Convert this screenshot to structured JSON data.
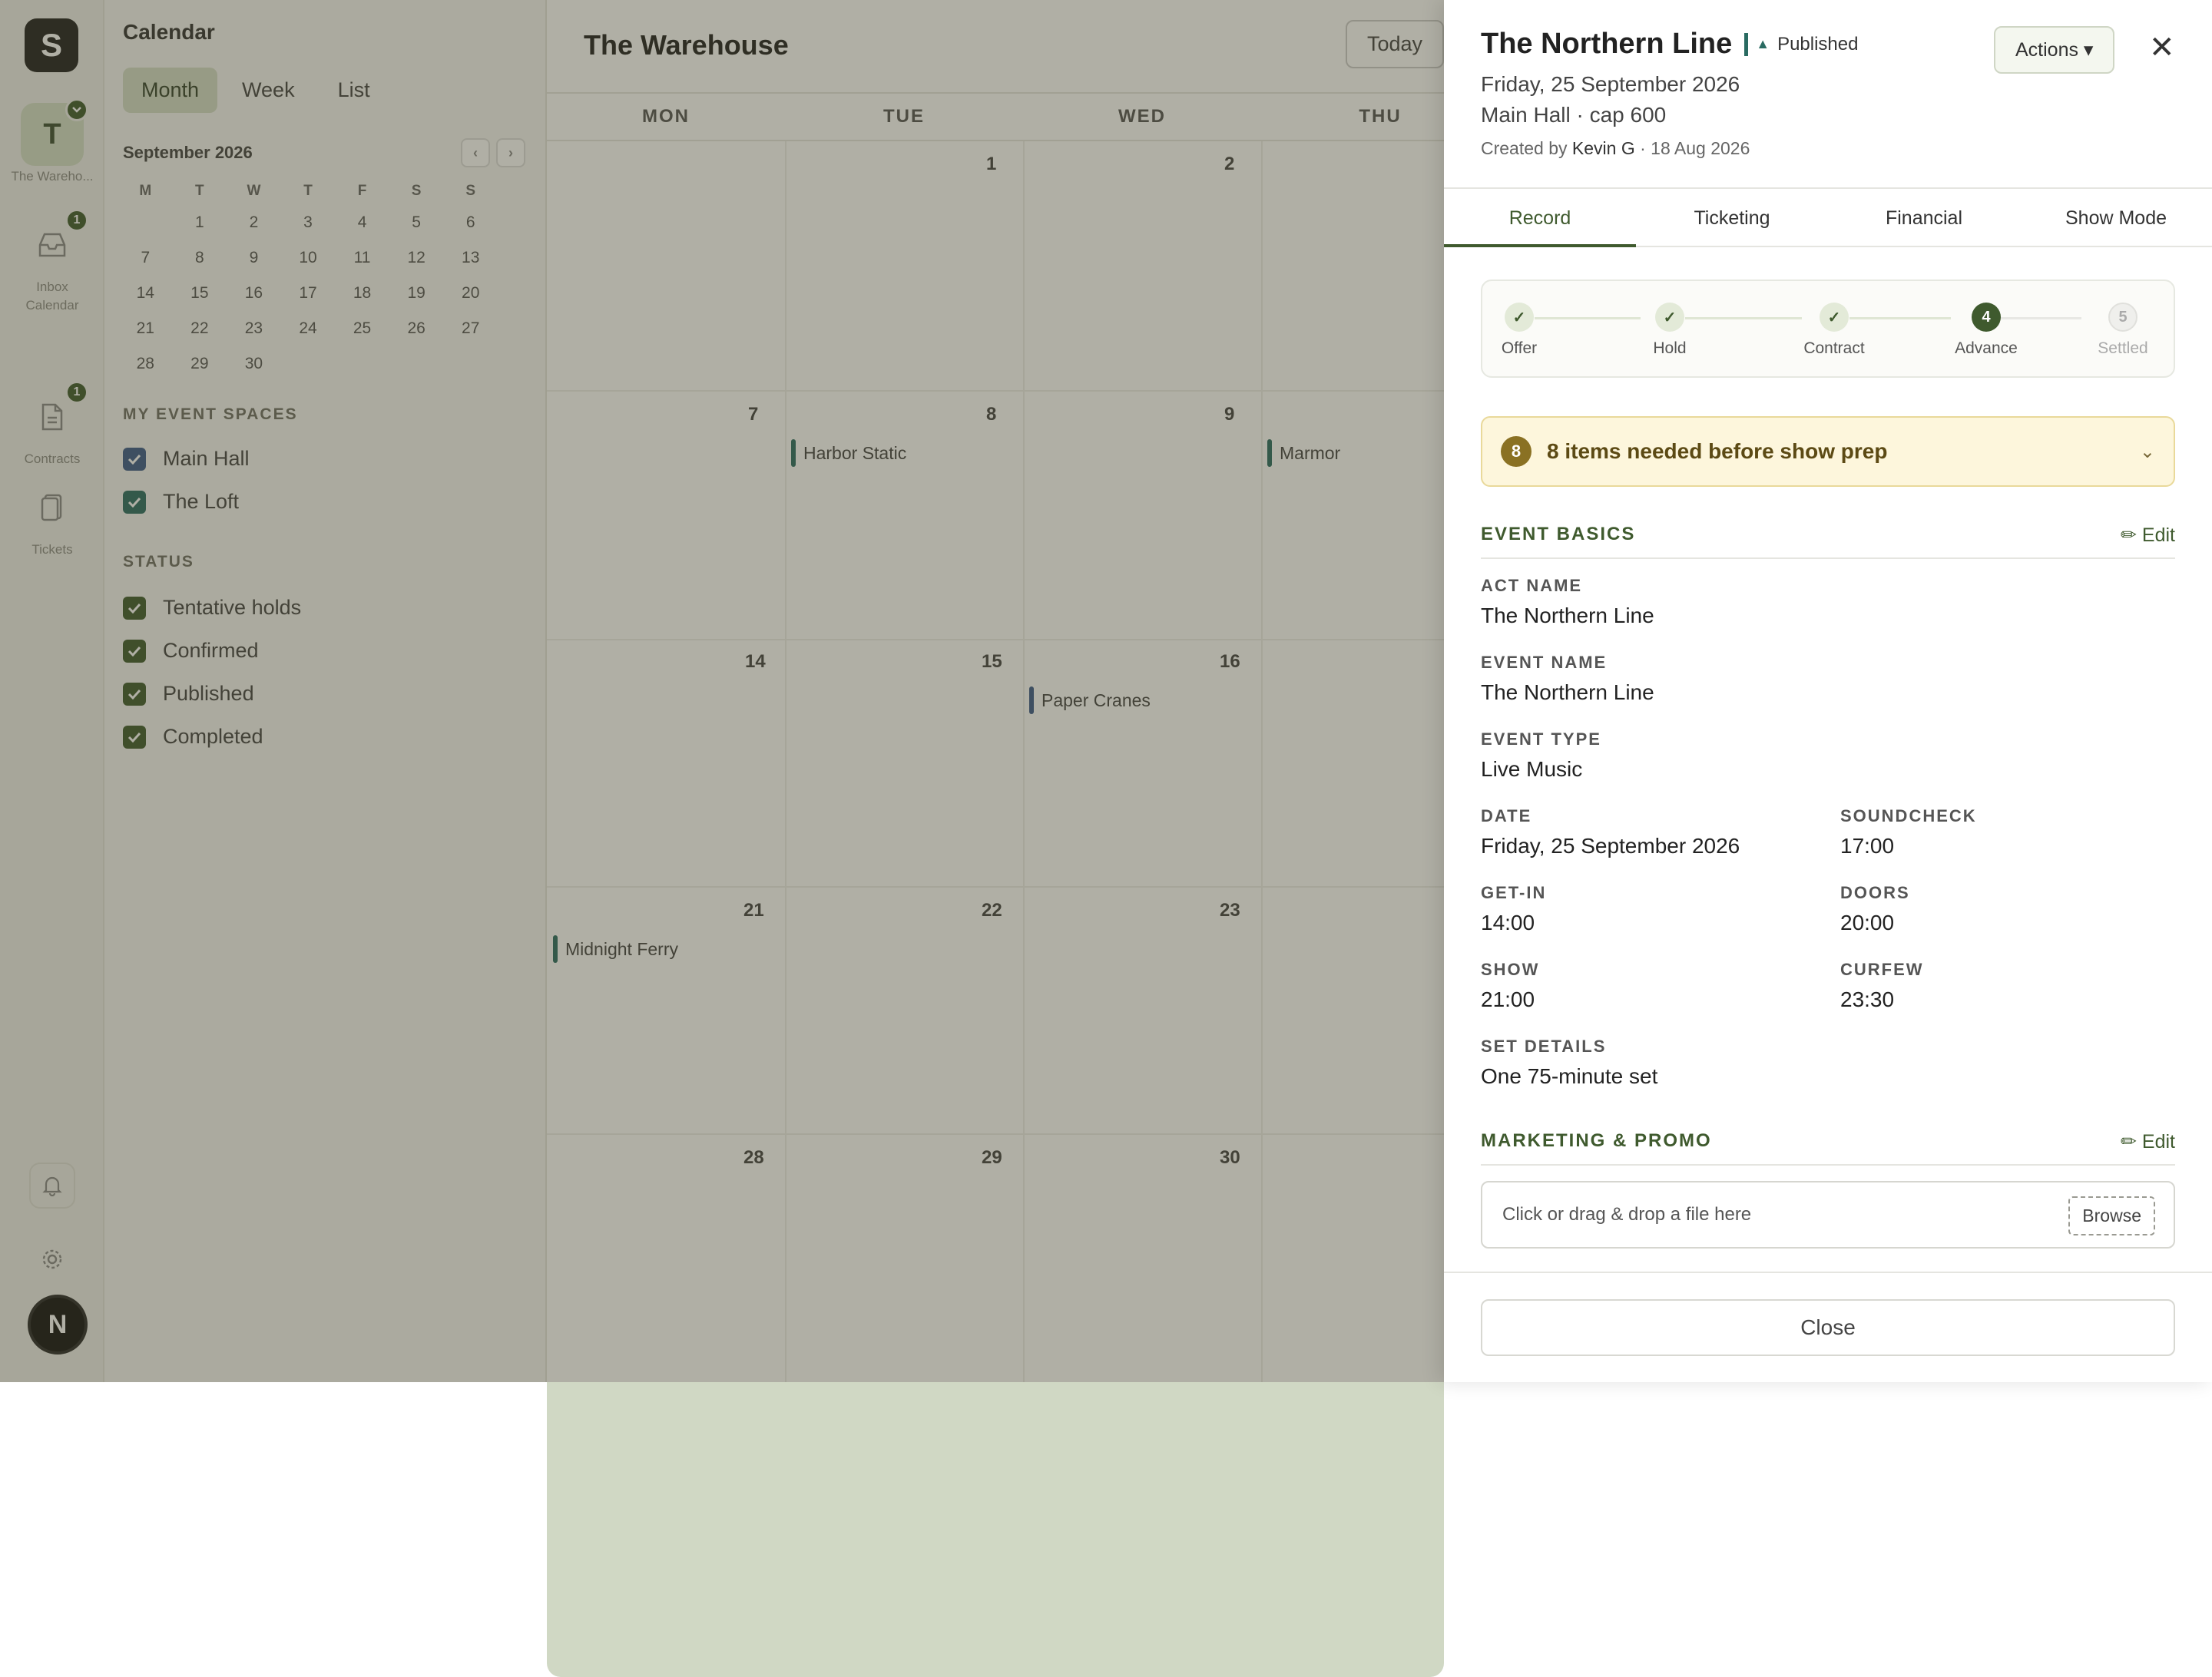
{
  "rail": {
    "logo": "S",
    "workspace": {
      "initial": "T",
      "label": "The Wareho..."
    },
    "items": [
      {
        "label": "Inbox",
        "badge": "1"
      },
      {
        "label": "Calendar"
      },
      {
        "label": "Contracts",
        "badge": "1"
      },
      {
        "label": "Tickets"
      }
    ],
    "avatar": "N"
  },
  "sidebar": {
    "title": "Calendar",
    "view_tabs": [
      "Month",
      "Week",
      "List"
    ],
    "mini_calendar": {
      "month_label": "September 2026",
      "prev": "‹",
      "next": "›",
      "dow": [
        "M",
        "T",
        "W",
        "T",
        "F",
        "S",
        "S"
      ],
      "days": [
        "",
        "1",
        "2",
        "3",
        "4",
        "5",
        "6",
        "7",
        "8",
        "9",
        "10",
        "11",
        "12",
        "13",
        "14",
        "15",
        "16",
        "17",
        "18",
        "19",
        "20",
        "21",
        "22",
        "23",
        "24",
        "25",
        "26",
        "27",
        "28",
        "29",
        "30"
      ]
    },
    "spaces_heading": "MY EVENT SPACES",
    "spaces": [
      {
        "label": "Main Hall",
        "color": "#3b5a8a"
      },
      {
        "label": "The Loft",
        "color": "#2a6b62"
      }
    ],
    "status_heading": "STATUS",
    "statuses": [
      "Tentative holds",
      "Confirmed",
      "Published",
      "Completed"
    ]
  },
  "calendar": {
    "title": "The Warehouse",
    "today_label": "Today",
    "dow": [
      "MON",
      "TUE",
      "WED",
      "THU"
    ],
    "week_numbers": [
      [
        "",
        "1",
        "2"
      ],
      [
        "7",
        "8",
        "9"
      ],
      [
        "14",
        "15",
        "16"
      ],
      [
        "21",
        "22",
        "23"
      ],
      [
        "28",
        "29",
        "30"
      ]
    ],
    "events": [
      {
        "title": "Harbor Static",
        "color": "#2a6b62"
      },
      {
        "title": "Marmor",
        "color": "#2a6b62"
      },
      {
        "title": "Paper Cranes",
        "color": "#3b5a8a"
      },
      {
        "title": "Midnight Ferry",
        "color": "#2a6b62"
      }
    ]
  },
  "drawer": {
    "title": "The Northern Line",
    "status": "Published",
    "date": "Friday, 25 September 2026",
    "venue": "Main Hall · cap 600",
    "created_prefix": "Created by",
    "created_by": "Kevin G",
    "created_date": "· 18 Aug 2026",
    "actions_label": "Actions ▾",
    "close_icon": "✕",
    "tabs": [
      "Record",
      "Ticketing",
      "Financial",
      "Show Mode"
    ],
    "steps": [
      {
        "label": "Offer",
        "mark": "✓",
        "state": "done"
      },
      {
        "label": "Hold",
        "mark": "✓",
        "state": "done"
      },
      {
        "label": "Contract",
        "mark": "✓",
        "state": "done"
      },
      {
        "label": "Advance",
        "mark": "4",
        "state": "current"
      },
      {
        "label": "Settled",
        "mark": "5",
        "state": "pending"
      }
    ],
    "alert": {
      "count": "8",
      "text": "8 items needed before show prep",
      "chevron": "⌄"
    },
    "event_basics": {
      "heading": "EVENT BASICS",
      "edit_label": "✏ Edit",
      "fields": [
        {
          "label": "ACT NAME",
          "value": "The Northern Line"
        },
        {
          "label": "EVENT NAME",
          "value": "The Northern Line"
        },
        {
          "label": "EVENT TYPE",
          "value": "Live Music"
        },
        {
          "label": "DATE",
          "value": "Friday, 25 September 2026"
        },
        {
          "label": "SOUNDCHECK",
          "value": "17:00"
        },
        {
          "label": "GET-IN",
          "value": "14:00"
        },
        {
          "label": "DOORS",
          "value": "20:00"
        },
        {
          "label": "SHOW",
          "value": "21:00"
        },
        {
          "label": "CURFEW",
          "value": "23:30"
        },
        {
          "label": "SET DETAILS",
          "value": "One 75-minute set"
        }
      ]
    },
    "marketing": {
      "heading": "MARKETING & PROMO",
      "edit_label": "✏ Edit",
      "dropzone_text": "Click or drag & drop a file here",
      "browse_label": "Browse"
    },
    "footer_close": "Close"
  }
}
